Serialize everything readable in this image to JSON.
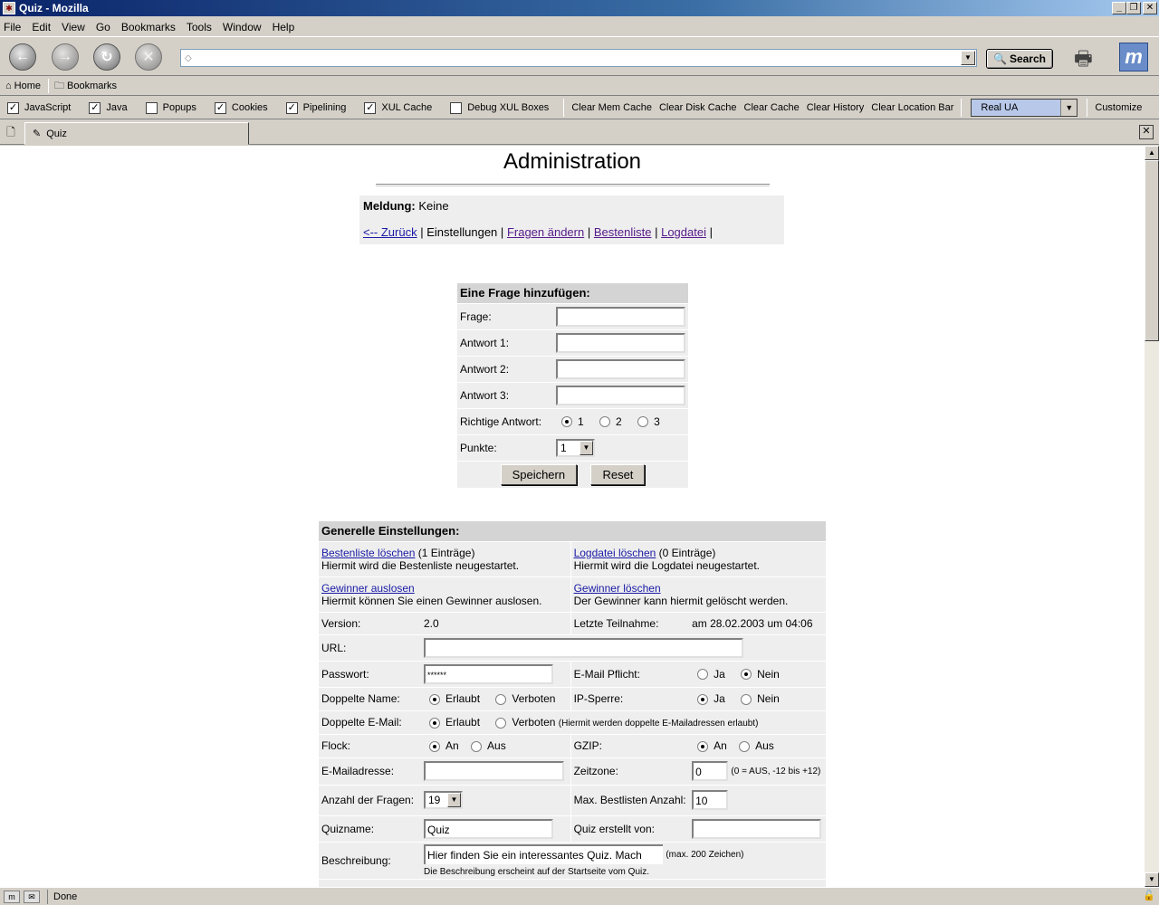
{
  "window": {
    "title": "Quiz - Mozilla",
    "controls": {
      "minimize": "_",
      "maximize": "̲",
      "close": "✕"
    }
  },
  "menu": [
    "File",
    "Edit",
    "View",
    "Go",
    "Bookmarks",
    "Tools",
    "Window",
    "Help"
  ],
  "navigation": {
    "url": "",
    "search_label": "Search"
  },
  "personal_toolbar": {
    "home": "Home",
    "bookmarks": "Bookmarks"
  },
  "prefbar": {
    "checkboxes": [
      {
        "label": "JavaScript",
        "checked": true
      },
      {
        "label": "Java",
        "checked": true
      },
      {
        "label": "Popups",
        "checked": false
      },
      {
        "label": "Cookies",
        "checked": true
      },
      {
        "label": "Pipelining",
        "checked": true
      },
      {
        "label": "XUL Cache",
        "checked": true
      },
      {
        "label": "Debug XUL Boxes",
        "checked": false
      }
    ],
    "buttons": [
      "Clear Mem Cache",
      "Clear Disk Cache",
      "Clear Cache",
      "Clear History",
      "Clear Location Bar"
    ],
    "ua_select": "Real UA",
    "customize": "Customize"
  },
  "tabs": [
    {
      "label": "Quiz"
    }
  ],
  "status": {
    "text": "Done"
  },
  "page": {
    "title": "Administration",
    "message_label": "Meldung:",
    "message_value": "Keine",
    "nav": {
      "back": "<-- Zurück",
      "settings": "Einstellungen",
      "edit_questions": "Fragen ändern",
      "leaderboard": "Bestenliste",
      "logfile": "Logdatei",
      "sep": "|"
    },
    "add_question": {
      "header": "Eine Frage hinzufügen:",
      "question_label": "Frage:",
      "answer1_label": "Antwort 1:",
      "answer2_label": "Antwort 2:",
      "answer3_label": "Antwort 3:",
      "correct_label": "Richtige Antwort:",
      "correct_options": [
        "1",
        "2",
        "3"
      ],
      "correct_selected": "1",
      "points_label": "Punkte:",
      "points_value": "1",
      "save": "Speichern",
      "reset": "Reset"
    },
    "general": {
      "header": "Generelle Einstellungen:",
      "clear_leaderboard": "Bestenliste löschen",
      "leaderboard_count": "(1 Einträge)",
      "clear_leaderboard_desc": "Hiermit wird die Bestenliste neugestartet.",
      "clear_logfile": "Logdatei löschen",
      "logfile_count": "(0 Einträge)",
      "clear_logfile_desc": "Hiermit wird die Logdatei neugestartet.",
      "draw_winner": "Gewinner auslosen",
      "draw_winner_desc": "Hiermit können Sie einen Gewinner auslosen.",
      "delete_winner": "Gewinner löschen",
      "delete_winner_desc": "Der Gewinner kann hiermit gelöscht werden.",
      "version_label": "Version:",
      "version_value": "2.0",
      "last_label": "Letzte Teilnahme:",
      "last_value": "am 28.02.2003 um 04:06",
      "url_label": "URL:",
      "url_value": "",
      "password_label": "Passwort:",
      "password_value": "******",
      "email_required_label": "E-Mail Pflicht:",
      "yes": "Ja",
      "no": "Nein",
      "dup_name_label": "Doppelte Name:",
      "allowed": "Erlaubt",
      "forbidden": "Verboten",
      "ip_lock_label": "IP-Sperre:",
      "dup_email_label": "Doppelte E-Mail:",
      "dup_email_note": "(Hiermit werden doppelte E-Mailadressen erlaubt)",
      "flock_label": "Flock:",
      "on": "An",
      "off": "Aus",
      "gzip_label": "GZIP:",
      "email_label": "E-Mailadresse:",
      "email_value": "",
      "timezone_label": "Zeitzone:",
      "timezone_value": "0",
      "timezone_note": "(0 = AUS, -12 bis +12)",
      "num_questions_label": "Anzahl der Fragen:",
      "num_questions_value": "19",
      "max_leaders_label": "Max. Bestlisten Anzahl:",
      "max_leaders_value": "10",
      "quizname_label": "Quizname:",
      "quizname_value": "Quiz",
      "created_by_label": "Quiz erstellt von:",
      "created_by_value": "",
      "description_label": "Beschreibung:",
      "description_value": "Hier finden Sie ein interessantes Quiz. Mach",
      "description_max": "(max. 200 Zeichen)",
      "description_note": "Die Beschreibung erscheint auf der Startseite vom Quiz."
    }
  }
}
